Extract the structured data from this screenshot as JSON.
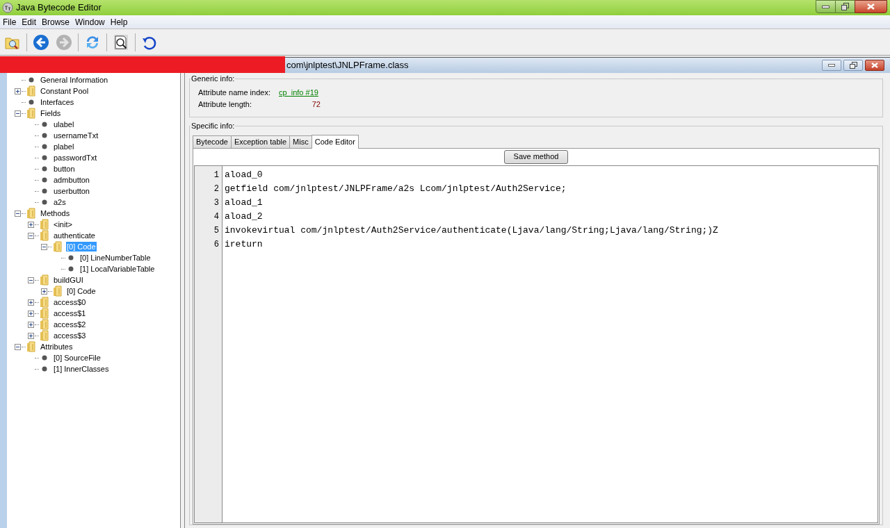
{
  "window": {
    "title": "Java Bytecode Editor"
  },
  "menu": [
    "File",
    "Edit",
    "Browse",
    "Window",
    "Help"
  ],
  "toolbar": [
    {
      "kind": "open",
      "disabled": false
    },
    {
      "kind": "back",
      "disabled": false
    },
    {
      "kind": "forward",
      "disabled": true
    },
    {
      "kind": "refresh",
      "disabled": false
    },
    {
      "kind": "inspect",
      "disabled": false
    },
    {
      "kind": "reload",
      "disabled": false
    }
  ],
  "document": {
    "title": "com\\jnlptest\\JNLPFrame.class"
  },
  "tree": [
    {
      "label": "General Information",
      "kind": "leaf",
      "selected": false
    },
    {
      "label": "Constant Pool",
      "kind": "folder",
      "expanded": false,
      "selected": false
    },
    {
      "label": "Interfaces",
      "kind": "leaf",
      "selected": false
    },
    {
      "label": "Fields",
      "kind": "folder",
      "expanded": true,
      "selected": false,
      "children": [
        {
          "label": "ulabel",
          "kind": "leaf",
          "selected": false
        },
        {
          "label": "usernameTxt",
          "kind": "leaf",
          "selected": false
        },
        {
          "label": "plabel",
          "kind": "leaf",
          "selected": false
        },
        {
          "label": "passwordTxt",
          "kind": "leaf",
          "selected": false
        },
        {
          "label": "button",
          "kind": "leaf",
          "selected": false
        },
        {
          "label": "admbutton",
          "kind": "leaf",
          "selected": false
        },
        {
          "label": "userbutton",
          "kind": "leaf",
          "selected": false
        },
        {
          "label": "a2s",
          "kind": "leaf",
          "selected": false
        }
      ]
    },
    {
      "label": "Methods",
      "kind": "folder",
      "expanded": true,
      "selected": false,
      "children": [
        {
          "label": "<init>",
          "kind": "folder",
          "expanded": false,
          "selected": false
        },
        {
          "label": "authenticate",
          "kind": "folder",
          "expanded": true,
          "selected": false,
          "children": [
            {
              "label": "[0] Code",
              "kind": "folder",
              "expanded": true,
              "selected": true,
              "children": [
                {
                  "label": "[0] LineNumberTable",
                  "kind": "leaf",
                  "selected": false
                },
                {
                  "label": "[1] LocalVariableTable",
                  "kind": "leaf",
                  "selected": false
                }
              ]
            }
          ]
        },
        {
          "label": "buildGUI",
          "kind": "folder",
          "expanded": true,
          "selected": false,
          "children": [
            {
              "label": "[0] Code",
              "kind": "folder",
              "expanded": false,
              "selected": false
            }
          ]
        },
        {
          "label": "access$0",
          "kind": "folder",
          "expanded": false,
          "selected": false
        },
        {
          "label": "access$1",
          "kind": "folder",
          "expanded": false,
          "selected": false
        },
        {
          "label": "access$2",
          "kind": "folder",
          "expanded": false,
          "selected": false
        },
        {
          "label": "access$3",
          "kind": "folder",
          "expanded": false,
          "selected": false
        }
      ]
    },
    {
      "label": "Attributes",
      "kind": "folder",
      "expanded": true,
      "selected": false,
      "children": [
        {
          "label": "[0] SourceFile",
          "kind": "leaf",
          "selected": false
        },
        {
          "label": "[1] InnerClasses",
          "kind": "leaf",
          "selected": false
        }
      ]
    }
  ],
  "generic_info": {
    "legend": "Generic info:",
    "fields": [
      {
        "label": "Attribute name index:",
        "value": "cp_info #19",
        "kind": "link"
      },
      {
        "label": "Attribute length:",
        "value": "72",
        "kind": "number"
      }
    ]
  },
  "specific_info": {
    "legend": "Specific info:",
    "tabs": [
      {
        "label": "Bytecode",
        "selected": false
      },
      {
        "label": "Exception table",
        "selected": false
      },
      {
        "label": "Misc",
        "selected": false
      },
      {
        "label": "Code Editor",
        "selected": true
      }
    ],
    "save_button": "Save method",
    "code_lines": [
      {
        "number": "1",
        "text": "aload_0"
      },
      {
        "number": "2",
        "text": "getfield com/jnlptest/JNLPFrame/a2s Lcom/jnlptest/Auth2Service;"
      },
      {
        "number": "3",
        "text": "aload_1"
      },
      {
        "number": "4",
        "text": "aload_2"
      },
      {
        "number": "5",
        "text": "invokevirtual com/jnlptest/Auth2Service/authenticate(Ljava/lang/String;Ljava/lang/String;)Z"
      },
      {
        "number": "6",
        "text": "ireturn"
      }
    ]
  }
}
